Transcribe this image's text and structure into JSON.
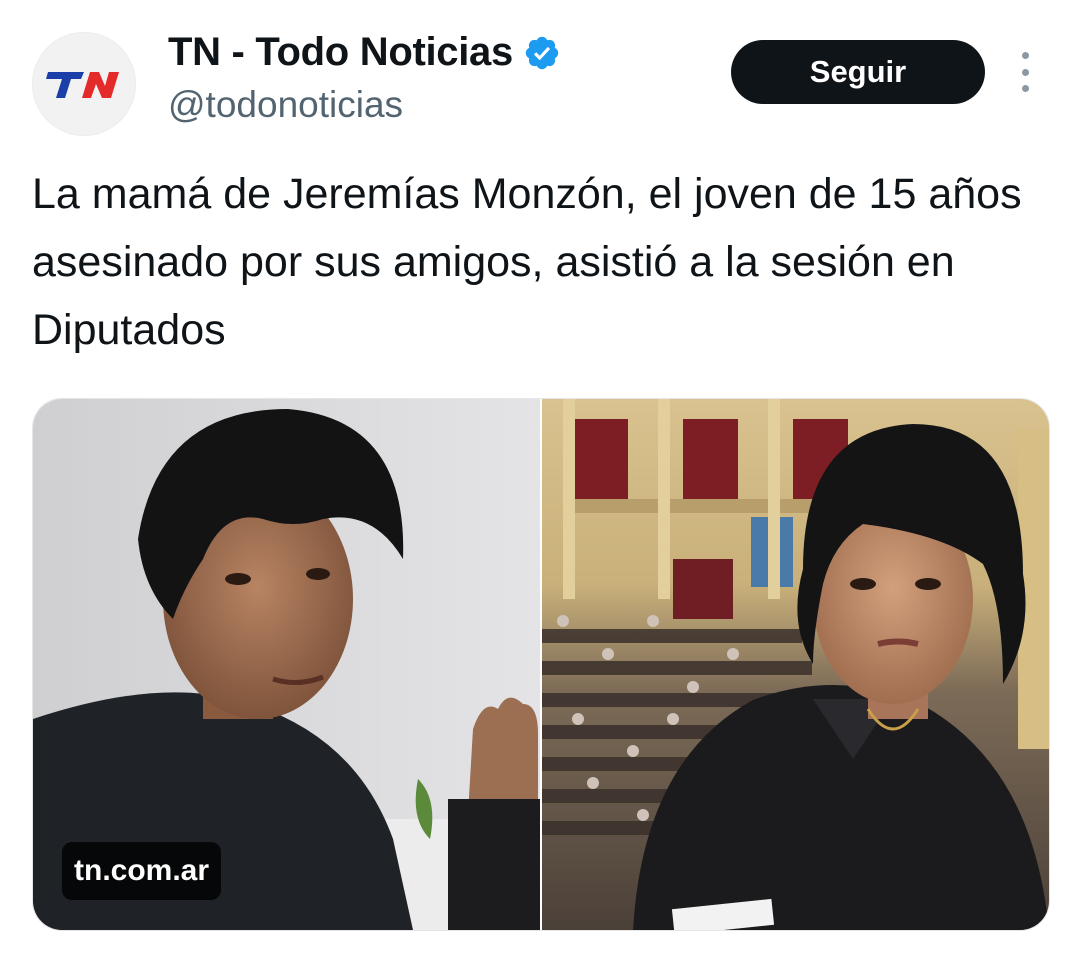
{
  "author": {
    "display_name": "TN - Todo Noticias",
    "handle": "@todonoticias",
    "verified": true,
    "avatar_icon": "tn-logo-icon",
    "brand_color": "#1a3fa8"
  },
  "actions": {
    "follow_label": "Seguir",
    "more_icon": "more-vertical-icon"
  },
  "tweet": {
    "text": "La mamá de Jeremías Monzón, el joven de 15 años asesinado por sus amigos, asistió a la sesión en Diputados"
  },
  "media": {
    "domain": "tn.com.ar"
  },
  "colors": {
    "accent": "#1d9bf0",
    "button_bg": "#0f1419",
    "secondary_text": "#536471"
  }
}
